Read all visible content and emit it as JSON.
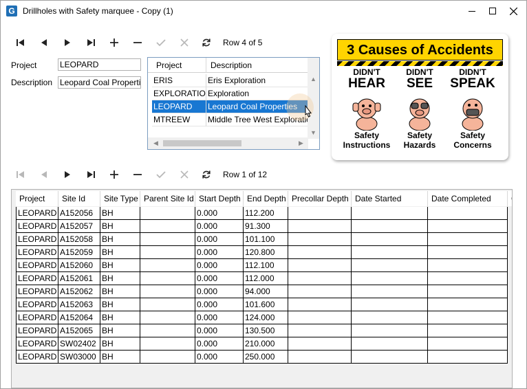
{
  "window": {
    "icon_letter": "G",
    "title": "Drillholes with Safety marquee - Copy (1)"
  },
  "top_nav": {
    "row_info": "Row 4 of 5"
  },
  "bottom_nav": {
    "row_info": "Row 1 of 12"
  },
  "form": {
    "project_label": "Project",
    "project_value": "LEOPARD",
    "description_label": "Description",
    "description_value": "Leopard Coal Properties"
  },
  "dropdown": {
    "columns": [
      "Project",
      "Description"
    ],
    "rows": [
      {
        "project": "ERIS",
        "description": "Eris Exploration",
        "selected": false
      },
      {
        "project": "EXPLORATION",
        "description": "Exploration",
        "selected": false
      },
      {
        "project": "LEOPARD",
        "description": "Leopard Coal Properties",
        "selected": true
      },
      {
        "project": "MTREEW",
        "description": "Middle Tree West Exploration",
        "selected": false
      }
    ]
  },
  "sign": {
    "title": "3 Causes of Accidents",
    "columns": [
      {
        "top": "DIDN'T",
        "big": "HEAR",
        "b1": "Safety",
        "b2": "Instructions"
      },
      {
        "top": "DIDN'T",
        "big": "SEE",
        "b1": "Safety",
        "b2": "Hazards"
      },
      {
        "top": "DIDN'T",
        "big": "SPEAK",
        "b1": "Safety",
        "b2": "Concerns"
      }
    ],
    "colors": {
      "banner": "#ffd400",
      "pig": "#f5b49a"
    }
  },
  "grid": {
    "columns": [
      "Project",
      "Site Id",
      "Site Type",
      "Parent Site Id",
      "Start Depth",
      "End Depth",
      "Precollar Depth",
      "Date Started",
      "Date Completed",
      "G"
    ],
    "rows": [
      [
        "LEOPARD",
        "A152056",
        "BH",
        "",
        "0.000",
        "112.200",
        "",
        "",
        ""
      ],
      [
        "LEOPARD",
        "A152057",
        "BH",
        "",
        "0.000",
        "91.300",
        "",
        "",
        ""
      ],
      [
        "LEOPARD",
        "A152058",
        "BH",
        "",
        "0.000",
        "101.100",
        "",
        "",
        ""
      ],
      [
        "LEOPARD",
        "A152059",
        "BH",
        "",
        "0.000",
        "120.800",
        "",
        "",
        ""
      ],
      [
        "LEOPARD",
        "A152060",
        "BH",
        "",
        "0.000",
        "112.100",
        "",
        "",
        ""
      ],
      [
        "LEOPARD",
        "A152061",
        "BH",
        "",
        "0.000",
        "112.000",
        "",
        "",
        ""
      ],
      [
        "LEOPARD",
        "A152062",
        "BH",
        "",
        "0.000",
        "94.000",
        "",
        "",
        ""
      ],
      [
        "LEOPARD",
        "A152063",
        "BH",
        "",
        "0.000",
        "101.600",
        "",
        "",
        ""
      ],
      [
        "LEOPARD",
        "A152064",
        "BH",
        "",
        "0.000",
        "124.000",
        "",
        "",
        ""
      ],
      [
        "LEOPARD",
        "A152065",
        "BH",
        "",
        "0.000",
        "130.500",
        "",
        "",
        ""
      ],
      [
        "LEOPARD",
        "SW02402",
        "BH",
        "",
        "0.000",
        "210.000",
        "",
        "",
        ""
      ],
      [
        "LEOPARD",
        "SW03000",
        "BH",
        "",
        "0.000",
        "250.000",
        "",
        "",
        ""
      ]
    ]
  }
}
